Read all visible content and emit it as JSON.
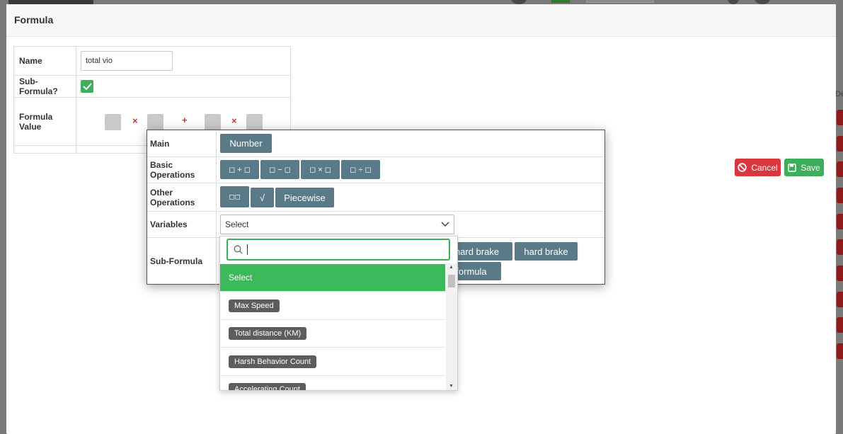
{
  "modal": {
    "title": "Formula"
  },
  "form": {
    "name_label": "Name",
    "name_value": "total vio",
    "subformula_label": "Sub-Formula?",
    "subformula_checked": true,
    "formula_value_label": "Formula Value",
    "formula_ops": [
      "×",
      "+",
      "×"
    ]
  },
  "actions": {
    "cancel_label": "Cancel",
    "save_label": "Save",
    "cancel_color": "#d9363e",
    "save_color": "#3cae5c"
  },
  "popup": {
    "main_label": "Main",
    "main_buttons": [
      "Number"
    ],
    "basic_label": "Basic Operations",
    "basic_buttons": [
      "◻ + ◻",
      "◻ − ◻",
      "◻ × ◻",
      "◻ ÷ ◻"
    ],
    "other_label": "Other Operations",
    "other_buttons": [
      "◻◻",
      "√",
      "Piecewise"
    ],
    "variables_label": "Variables",
    "variables_selected": "Select",
    "subformula_label": "Sub-Formula",
    "subformula_buttons": [
      "hard brake",
      "hard brake",
      "formula"
    ]
  },
  "dropdown": {
    "search_value": "",
    "options": [
      "Select",
      "Max Speed",
      "Total distance (KM)",
      "Harsh Behavior Count",
      "Accelerating Count"
    ],
    "selected_index": 0
  },
  "background": {
    "side_label": "De"
  }
}
